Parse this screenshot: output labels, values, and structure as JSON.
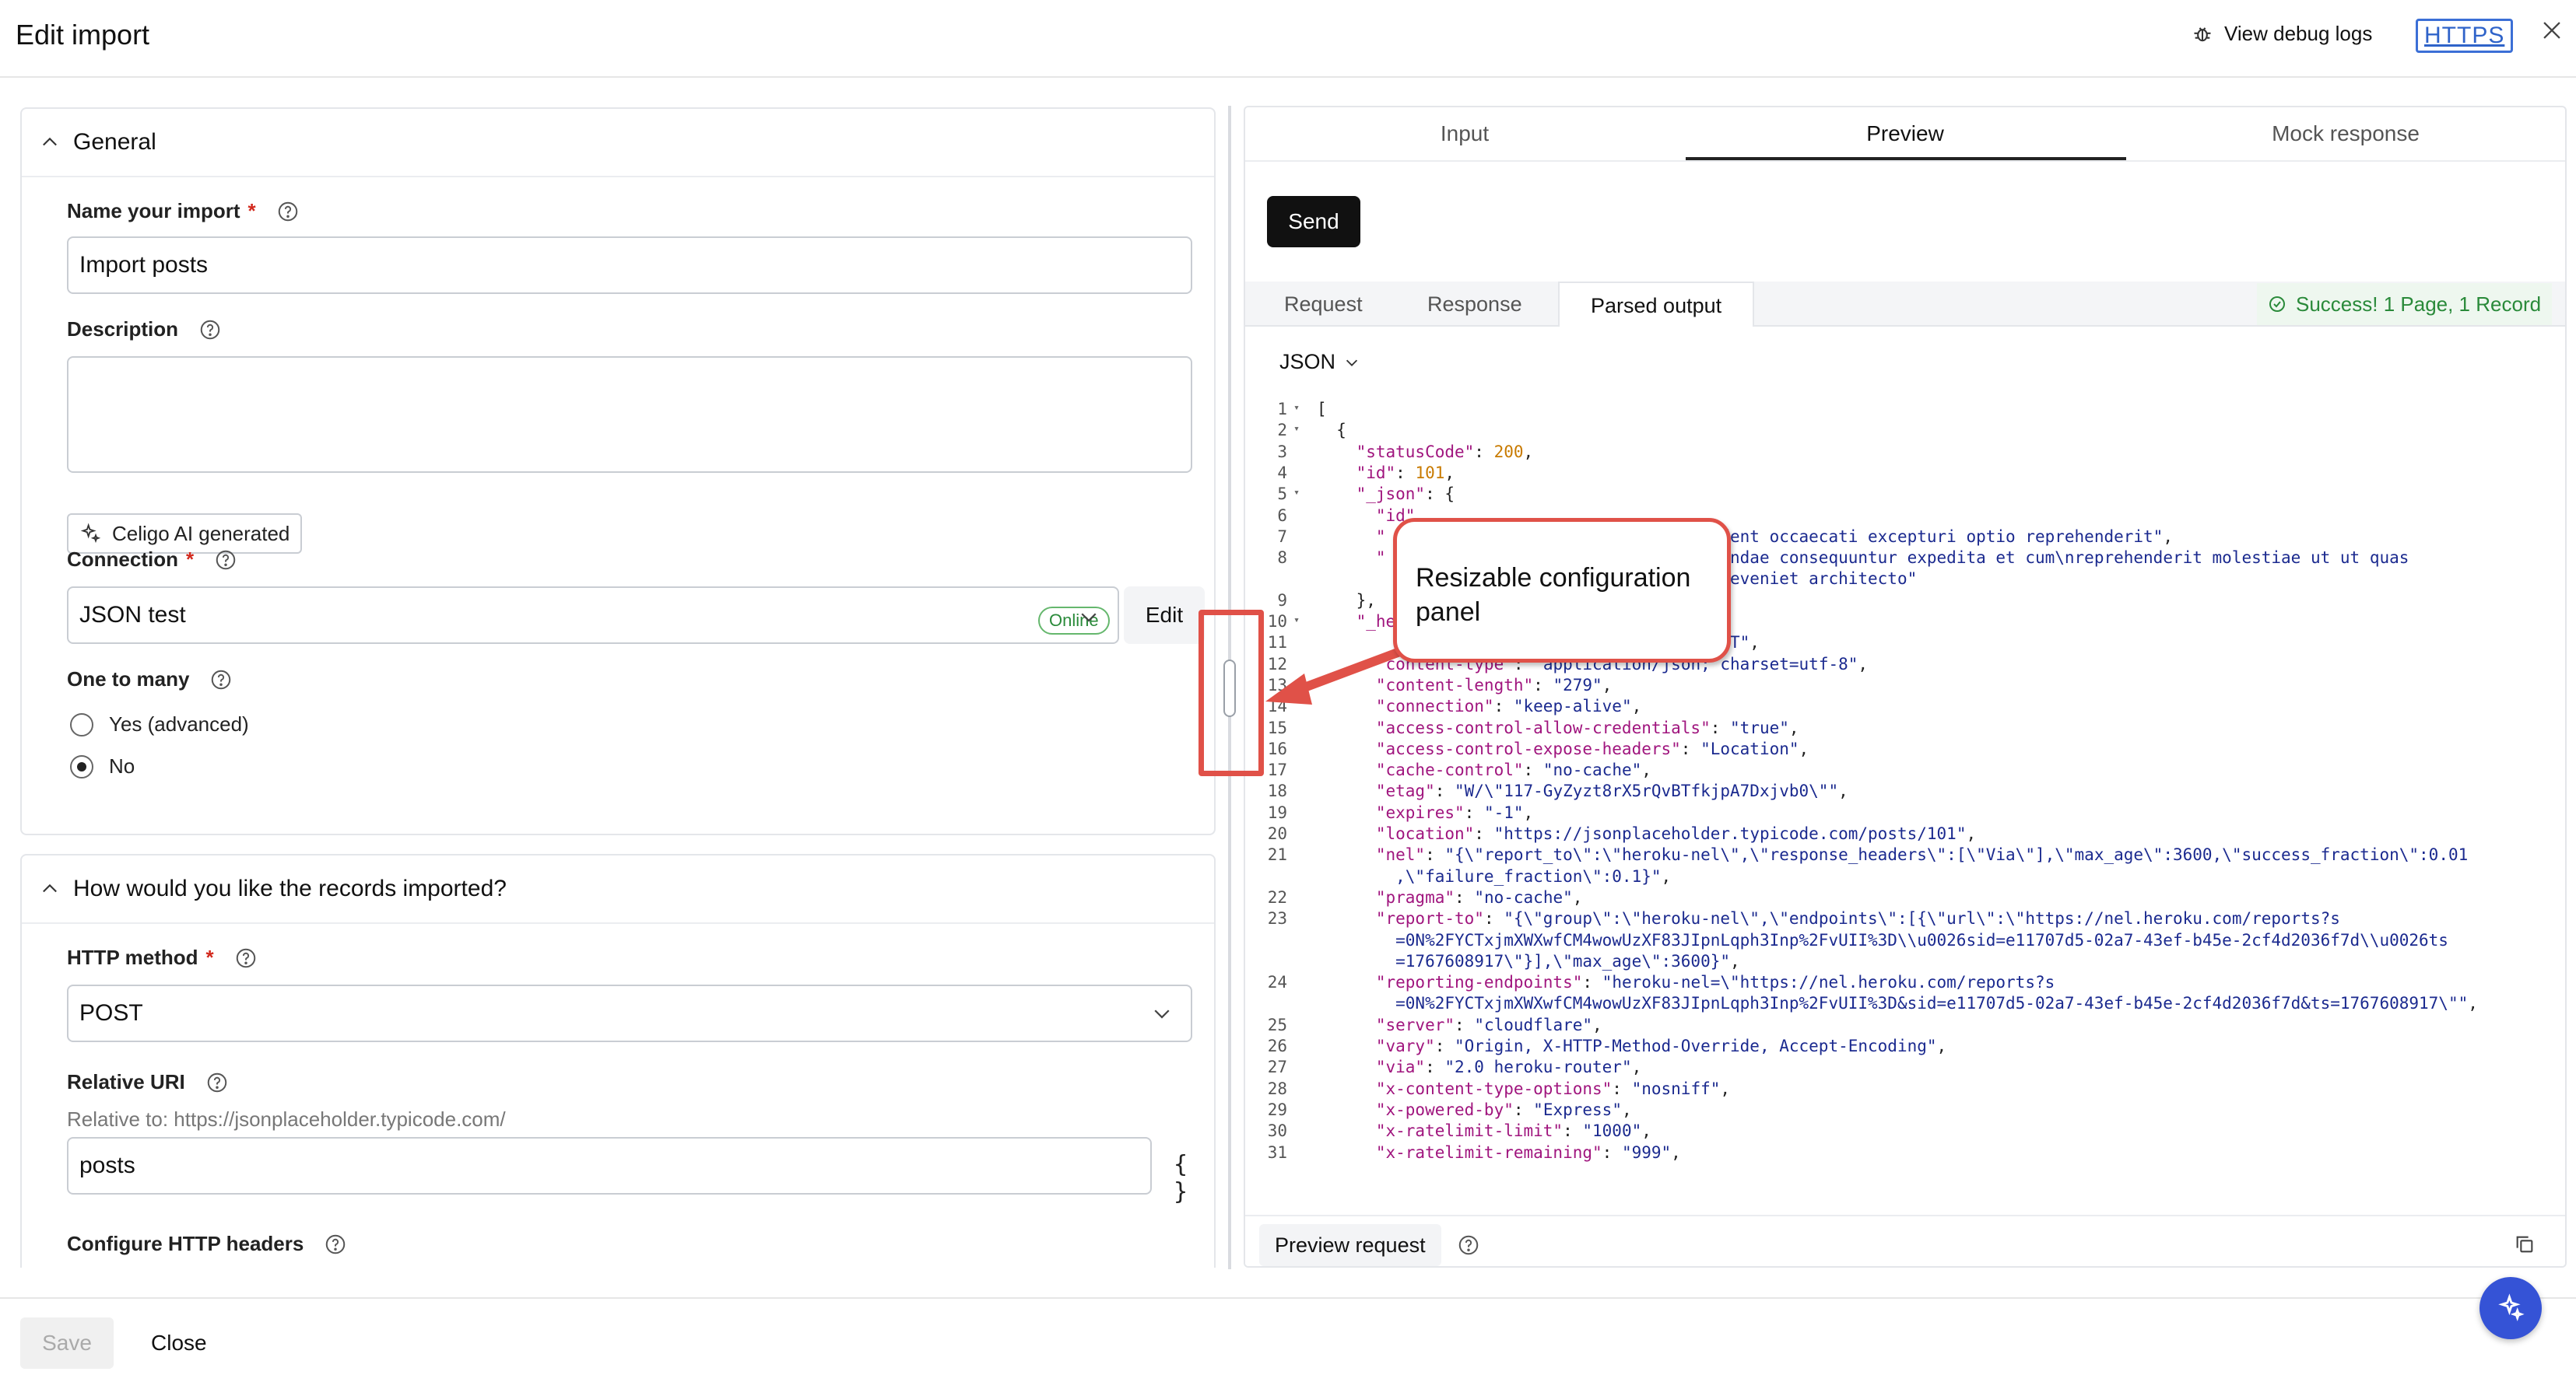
{
  "header": {
    "title": "Edit import",
    "debug_label": "View debug logs",
    "https_label": "HTTPS"
  },
  "general": {
    "section_title": "General",
    "name_label": "Name your import",
    "name_value": "Import posts",
    "description_label": "Description",
    "description_value": "",
    "ai_button_label": "Celigo AI generated",
    "connection_label": "Connection",
    "connection_value": "JSON test",
    "connection_status": "Online",
    "edit_label": "Edit",
    "one_to_many_label": "One to many",
    "options": [
      {
        "label": "Yes (advanced)",
        "selected": false
      },
      {
        "label": "No",
        "selected": true
      }
    ]
  },
  "import_section": {
    "section_title": "How would you like the records imported?",
    "http_method_label": "HTTP method",
    "http_method_value": "POST",
    "relative_uri_label": "Relative URI",
    "relative_to": "Relative to: https://jsonplaceholder.typicode.com/",
    "relative_uri_value": "posts",
    "braces": "{ }",
    "headers_label": "Configure HTTP headers"
  },
  "right_panel": {
    "tabs": [
      {
        "label": "Input",
        "active": false
      },
      {
        "label": "Preview",
        "active": true
      },
      {
        "label": "Mock response",
        "active": false
      }
    ],
    "send_label": "Send",
    "subtabs": [
      {
        "label": "Request",
        "active": false
      },
      {
        "label": "Response",
        "active": false
      },
      {
        "label": "Parsed output",
        "active": true
      }
    ],
    "success_text": "Success! 1 Page, 1 Record",
    "format": "JSON",
    "preview_request_label": "Preview request"
  },
  "code_lines": [
    {
      "n": "1",
      "fold": true,
      "segments": [
        {
          "t": "[",
          "c": "p"
        }
      ]
    },
    {
      "n": "2",
      "fold": true,
      "segments": [
        {
          "t": "  {",
          "c": "p"
        }
      ]
    },
    {
      "n": "3",
      "segments": [
        {
          "t": "    \"statusCode\"",
          "c": "k"
        },
        {
          "t": ": ",
          "c": "p"
        },
        {
          "t": "200",
          "c": "n"
        },
        {
          "t": ",",
          "c": "p"
        }
      ]
    },
    {
      "n": "4",
      "segments": [
        {
          "t": "    \"id\"",
          "c": "k"
        },
        {
          "t": ": ",
          "c": "p"
        },
        {
          "t": "101",
          "c": "n"
        },
        {
          "t": ",",
          "c": "p"
        }
      ]
    },
    {
      "n": "5",
      "fold": true,
      "segments": [
        {
          "t": "    \"_json\"",
          "c": "k"
        },
        {
          "t": ": {",
          "c": "p"
        }
      ]
    },
    {
      "n": "6",
      "segments": [
        {
          "t": "      \"id\"",
          "c": "k"
        }
      ]
    },
    {
      "n": "7",
      "segments": [
        {
          "t": "      \"",
          "c": "k"
        },
        {
          "t": "                             provident occaecati excepturi optio reprehenderit\"",
          "c": "s"
        },
        {
          "t": ",",
          "c": "p"
        }
      ]
    },
    {
      "n": "8",
      "segments": [
        {
          "t": "      \"",
          "c": "k"
        },
        {
          "t": "                             recusandae consequuntur expedita et cum\\nreprehenderit molestiae ut ut quas",
          "c": "s"
        }
      ]
    },
    {
      "n": "",
      "segments": [
        {
          "t": "                                   nt rem eveniet architecto\"",
          "c": "s"
        }
      ]
    },
    {
      "n": "9",
      "segments": [
        {
          "t": "    },",
          "c": "p"
        }
      ]
    },
    {
      "n": "10",
      "fold": true,
      "segments": [
        {
          "t": "    \"_he",
          "c": "k"
        }
      ]
    },
    {
      "n": "11",
      "segments": [
        {
          "t": "                                        GMT\"",
          "c": "s"
        },
        {
          "t": ",",
          "c": "p"
        }
      ]
    },
    {
      "n": "12",
      "segments": [
        {
          "t": "      \"content-type\"",
          "c": "k"
        },
        {
          "t": ": ",
          "c": "p"
        },
        {
          "t": "\"application/json; charset=utf-8\"",
          "c": "s"
        },
        {
          "t": ",",
          "c": "p"
        }
      ]
    },
    {
      "n": "13",
      "segments": [
        {
          "t": "      \"content-length\"",
          "c": "k"
        },
        {
          "t": ": ",
          "c": "p"
        },
        {
          "t": "\"279\"",
          "c": "s"
        },
        {
          "t": ",",
          "c": "p"
        }
      ]
    },
    {
      "n": "14",
      "segments": [
        {
          "t": "      \"connection\"",
          "c": "k"
        },
        {
          "t": ": ",
          "c": "p"
        },
        {
          "t": "\"keep-alive\"",
          "c": "s"
        },
        {
          "t": ",",
          "c": "p"
        }
      ]
    },
    {
      "n": "15",
      "segments": [
        {
          "t": "      \"access-control-allow-credentials\"",
          "c": "k"
        },
        {
          "t": ": ",
          "c": "p"
        },
        {
          "t": "\"true\"",
          "c": "s"
        },
        {
          "t": ",",
          "c": "p"
        }
      ]
    },
    {
      "n": "16",
      "segments": [
        {
          "t": "      \"access-control-expose-headers\"",
          "c": "k"
        },
        {
          "t": ": ",
          "c": "p"
        },
        {
          "t": "\"Location\"",
          "c": "s"
        },
        {
          "t": ",",
          "c": "p"
        }
      ]
    },
    {
      "n": "17",
      "segments": [
        {
          "t": "      \"cache-control\"",
          "c": "k"
        },
        {
          "t": ": ",
          "c": "p"
        },
        {
          "t": "\"no-cache\"",
          "c": "s"
        },
        {
          "t": ",",
          "c": "p"
        }
      ]
    },
    {
      "n": "18",
      "segments": [
        {
          "t": "      \"etag\"",
          "c": "k"
        },
        {
          "t": ": ",
          "c": "p"
        },
        {
          "t": "\"W/\\\"117-GyZyzt8rX5rQvBTfkjpA7Dxjvb0\\\"\"",
          "c": "s"
        },
        {
          "t": ",",
          "c": "p"
        }
      ]
    },
    {
      "n": "19",
      "segments": [
        {
          "t": "      \"expires\"",
          "c": "k"
        },
        {
          "t": ": ",
          "c": "p"
        },
        {
          "t": "\"-1\"",
          "c": "s"
        },
        {
          "t": ",",
          "c": "p"
        }
      ]
    },
    {
      "n": "20",
      "segments": [
        {
          "t": "      \"location\"",
          "c": "k"
        },
        {
          "t": ": ",
          "c": "p"
        },
        {
          "t": "\"https://jsonplaceholder.typicode.com/posts/101\"",
          "c": "s"
        },
        {
          "t": ",",
          "c": "p"
        }
      ]
    },
    {
      "n": "21",
      "segments": [
        {
          "t": "      \"nel\"",
          "c": "k"
        },
        {
          "t": ": ",
          "c": "p"
        },
        {
          "t": "\"{\\\"report_to\\\":\\\"heroku-nel\\\",\\\"response_headers\\\":[\\\"Via\\\"],\\\"max_age\\\":3600,\\\"success_fraction\\\":0.01",
          "c": "s"
        }
      ]
    },
    {
      "n": "",
      "segments": [
        {
          "t": "        ,\\\"failure_fraction\\\":0.1}\"",
          "c": "s"
        },
        {
          "t": ",",
          "c": "p"
        }
      ]
    },
    {
      "n": "22",
      "segments": [
        {
          "t": "      \"pragma\"",
          "c": "k"
        },
        {
          "t": ": ",
          "c": "p"
        },
        {
          "t": "\"no-cache\"",
          "c": "s"
        },
        {
          "t": ",",
          "c": "p"
        }
      ]
    },
    {
      "n": "23",
      "segments": [
        {
          "t": "      \"report-to\"",
          "c": "k"
        },
        {
          "t": ": ",
          "c": "p"
        },
        {
          "t": "\"{\\\"group\\\":\\\"heroku-nel\\\",\\\"endpoints\\\":[{\\\"url\\\":\\\"https://nel.heroku.com/reports?s",
          "c": "s"
        }
      ]
    },
    {
      "n": "",
      "segments": [
        {
          "t": "        =0N%2FYCTxjmXWXwfCM4wowUzXF83JIpnLqph3Inp%2FvUII%3D\\\\u0026sid=e11707d5-02a7-43ef-b45e-2cf4d2036f7d\\\\u0026ts",
          "c": "s"
        }
      ]
    },
    {
      "n": "",
      "segments": [
        {
          "t": "        =1767608917\\\"}],\\\"max_age\\\":3600}\"",
          "c": "s"
        },
        {
          "t": ",",
          "c": "p"
        }
      ]
    },
    {
      "n": "24",
      "segments": [
        {
          "t": "      \"reporting-endpoints\"",
          "c": "k"
        },
        {
          "t": ": ",
          "c": "p"
        },
        {
          "t": "\"heroku-nel=\\\"https://nel.heroku.com/reports?s",
          "c": "s"
        }
      ]
    },
    {
      "n": "",
      "segments": [
        {
          "t": "        =0N%2FYCTxjmXWXwfCM4wowUzXF83JIpnLqph3Inp%2FvUII%3D&sid=e11707d5-02a7-43ef-b45e-2cf4d2036f7d&ts=1767608917\\\"\"",
          "c": "s"
        },
        {
          "t": ",",
          "c": "p"
        }
      ]
    },
    {
      "n": "25",
      "segments": [
        {
          "t": "      \"server\"",
          "c": "k"
        },
        {
          "t": ": ",
          "c": "p"
        },
        {
          "t": "\"cloudflare\"",
          "c": "s"
        },
        {
          "t": ",",
          "c": "p"
        }
      ]
    },
    {
      "n": "26",
      "segments": [
        {
          "t": "      \"vary\"",
          "c": "k"
        },
        {
          "t": ": ",
          "c": "p"
        },
        {
          "t": "\"Origin, X-HTTP-Method-Override, Accept-Encoding\"",
          "c": "s"
        },
        {
          "t": ",",
          "c": "p"
        }
      ]
    },
    {
      "n": "27",
      "segments": [
        {
          "t": "      \"via\"",
          "c": "k"
        },
        {
          "t": ": ",
          "c": "p"
        },
        {
          "t": "\"2.0 heroku-router\"",
          "c": "s"
        },
        {
          "t": ",",
          "c": "p"
        }
      ]
    },
    {
      "n": "28",
      "segments": [
        {
          "t": "      \"x-content-type-options\"",
          "c": "k"
        },
        {
          "t": ": ",
          "c": "p"
        },
        {
          "t": "\"nosniff\"",
          "c": "s"
        },
        {
          "t": ",",
          "c": "p"
        }
      ]
    },
    {
      "n": "29",
      "segments": [
        {
          "t": "      \"x-powered-by\"",
          "c": "k"
        },
        {
          "t": ": ",
          "c": "p"
        },
        {
          "t": "\"Express\"",
          "c": "s"
        },
        {
          "t": ",",
          "c": "p"
        }
      ]
    },
    {
      "n": "30",
      "segments": [
        {
          "t": "      \"x-ratelimit-limit\"",
          "c": "k"
        },
        {
          "t": ": ",
          "c": "p"
        },
        {
          "t": "\"1000\"",
          "c": "s"
        },
        {
          "t": ",",
          "c": "p"
        }
      ]
    },
    {
      "n": "31",
      "segments": [
        {
          "t": "      \"x-ratelimit-remaining\"",
          "c": "k"
        },
        {
          "t": ": ",
          "c": "p"
        },
        {
          "t": "\"999\"",
          "c": "s"
        },
        {
          "t": ",",
          "c": "p"
        }
      ]
    }
  ],
  "annotation": {
    "callout_text": "Resizable configuration panel",
    "color": "#e05148"
  },
  "footer": {
    "save_label": "Save",
    "close_label": "Close"
  },
  "icons": {
    "debug": "bug-icon",
    "close": "close-icon",
    "help": "help-circle-icon",
    "collapse": "chevron-up-icon",
    "dropdown": "chevron-down-icon",
    "ai": "sparkle-icon",
    "success": "check-circle-icon",
    "popout": "copy-icon",
    "assistant": "ai-assistant-icon"
  },
  "colors": {
    "accent": "#3b6fd6",
    "success": "#2a8a3a",
    "required": "#d2291d",
    "primary_button": "#111111",
    "fab": "#3553d6"
  }
}
